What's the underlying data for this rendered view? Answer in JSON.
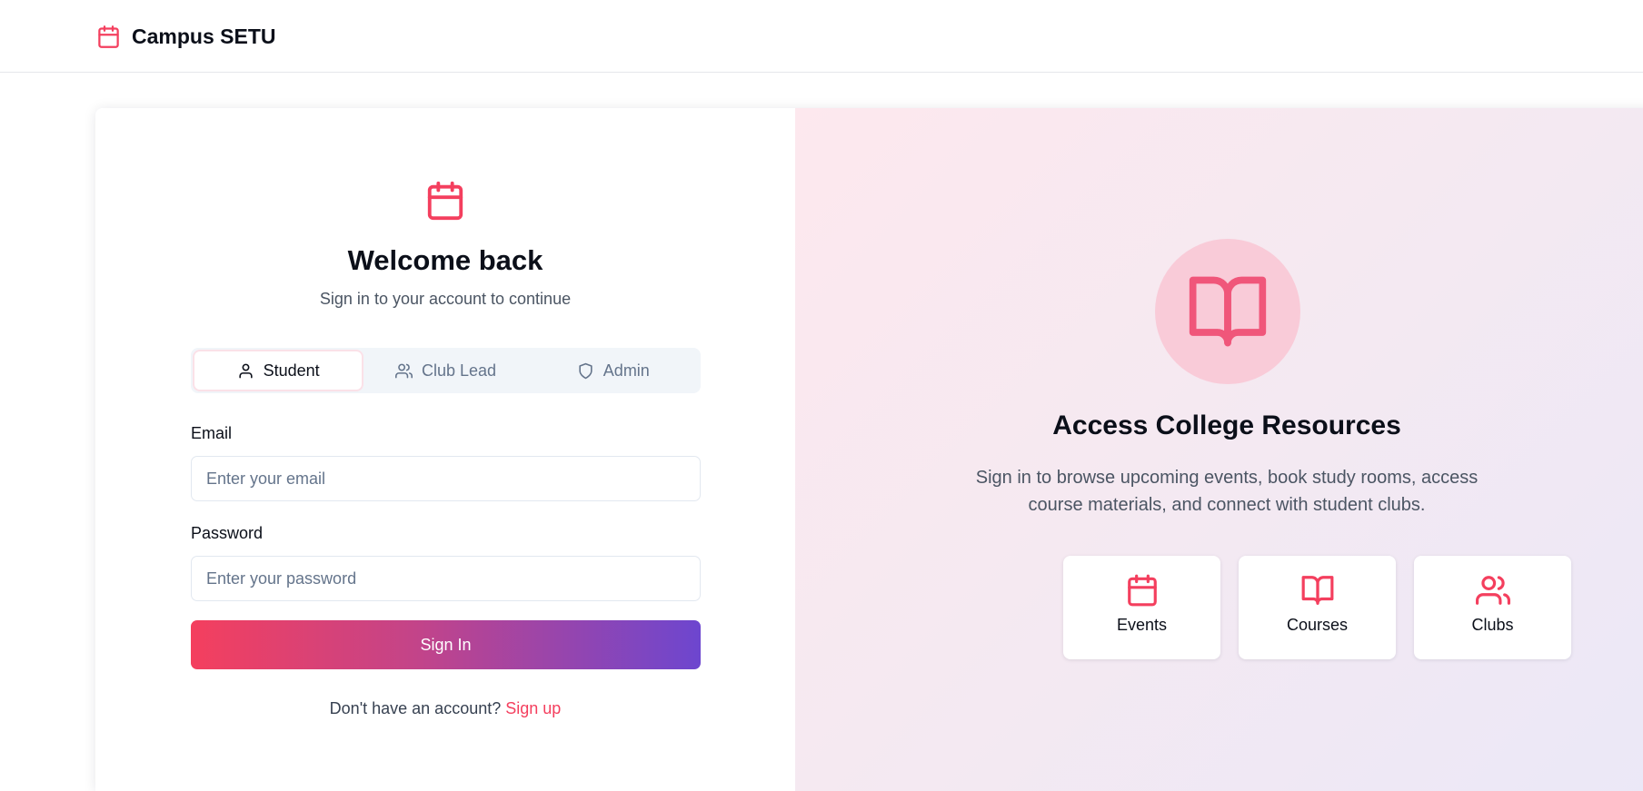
{
  "header": {
    "brand_name": "Campus SETU",
    "brand_icon": "calendar-icon"
  },
  "login": {
    "title": "Welcome back",
    "subtitle": "Sign in to your account to continue",
    "roles": [
      {
        "label": "Student",
        "icon": "user-icon",
        "active": true
      },
      {
        "label": "Club Lead",
        "icon": "users-icon",
        "active": false
      },
      {
        "label": "Admin",
        "icon": "shield-icon",
        "active": false
      }
    ],
    "email_label": "Email",
    "email_placeholder": "Enter your email",
    "email_value": "",
    "password_label": "Password",
    "password_placeholder": "Enter your password",
    "password_value": "",
    "submit_label": "Sign In",
    "signup_prompt": "Don't have an account?",
    "signup_link": "Sign up"
  },
  "promo": {
    "icon": "book-open-icon",
    "title": "Access College Resources",
    "description": "Sign in to browse upcoming events, book study rooms, access course materials, and connect with student clubs.",
    "features": [
      {
        "label": "Events",
        "icon": "calendar-icon"
      },
      {
        "label": "Courses",
        "icon": "book-open-icon"
      },
      {
        "label": "Clubs",
        "icon": "users-icon"
      }
    ]
  },
  "colors": {
    "accent": "#f43f5e",
    "gradient_start": "#f43f5e",
    "gradient_end": "#6d46cf",
    "promo_circle": "#f9cbd8"
  }
}
